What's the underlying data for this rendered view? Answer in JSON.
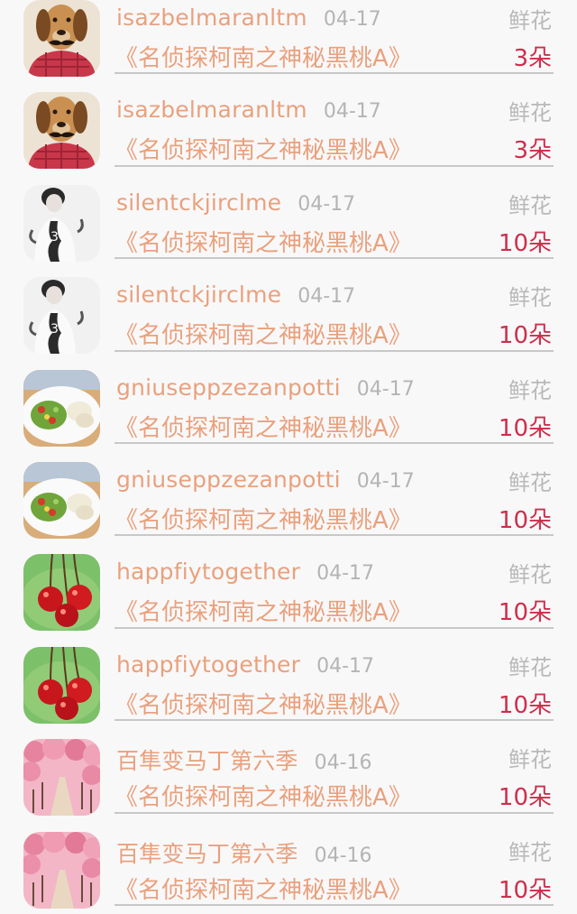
{
  "records": [
    {
      "name": "isazbelmaranltm",
      "date": "04-17",
      "gift_type": "鲜花",
      "show": "《名侦探柯南之神秘黑桃A》",
      "count": "3朵",
      "avatar": "dog-avatar"
    },
    {
      "name": "isazbelmaranltm",
      "date": "04-17",
      "gift_type": "鲜花",
      "show": "《名侦探柯南之神秘黑桃A》",
      "count": "3朵",
      "avatar": "dog-avatar"
    },
    {
      "name": "silentckjirclme",
      "date": "04-17",
      "gift_type": "鲜花",
      "show": "《名侦探柯南之神秘黑桃A》",
      "count": "10朵",
      "avatar": "person-avatar"
    },
    {
      "name": "silentckjirclme",
      "date": "04-17",
      "gift_type": "鲜花",
      "show": "《名侦探柯南之神秘黑桃A》",
      "count": "10朵",
      "avatar": "person-avatar"
    },
    {
      "name": "gniuseppzezanpotti",
      "date": "04-17",
      "gift_type": "鲜花",
      "show": "《名侦探柯南之神秘黑桃A》",
      "count": "10朵",
      "avatar": "food-plate-avatar"
    },
    {
      "name": "gniuseppzezanpotti",
      "date": "04-17",
      "gift_type": "鲜花",
      "show": "《名侦探柯南之神秘黑桃A》",
      "count": "10朵",
      "avatar": "food-plate-avatar"
    },
    {
      "name": "happfiytogether",
      "date": "04-17",
      "gift_type": "鲜花",
      "show": "《名侦探柯南之神秘黑桃A》",
      "count": "10朵",
      "avatar": "cherries-avatar"
    },
    {
      "name": "happfiytogether",
      "date": "04-17",
      "gift_type": "鲜花",
      "show": "《名侦探柯南之神秘黑桃A》",
      "count": "10朵",
      "avatar": "cherries-avatar"
    },
    {
      "name": "百隼变马丁第六季",
      "date": "04-16",
      "gift_type": "鲜花",
      "show": "《名侦探柯南之神秘黑桃A》",
      "count": "10朵",
      "avatar": "blossom-avatar"
    },
    {
      "name": "百隼变马丁第六季",
      "date": "04-16",
      "gift_type": "鲜花",
      "show": "《名侦探柯南之神秘黑桃A》",
      "count": "10朵",
      "avatar": "blossom-avatar"
    }
  ],
  "colors": {
    "name": "#e9a17d",
    "date": "#b4b4b4",
    "gift_type": "#b9b9b9",
    "count": "#cd2f4c",
    "divider": "#c8c8c8",
    "background": "#f9f8f9"
  }
}
